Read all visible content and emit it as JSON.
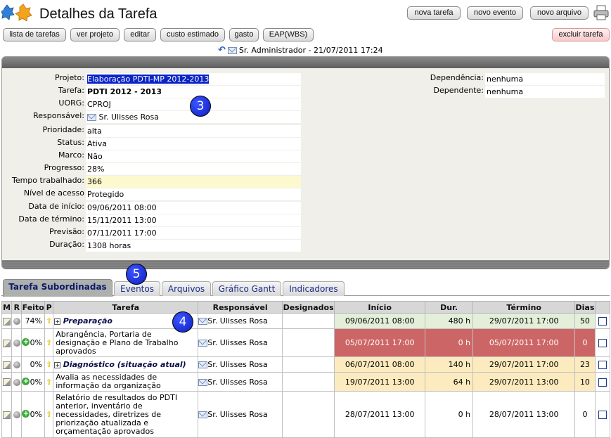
{
  "header": {
    "title": "Detalhes da Tarefa",
    "buttons": {
      "nova_tarefa": "nova tarefa",
      "novo_evento": "novo evento",
      "novo_arquivo": "novo arquivo"
    }
  },
  "toolbar": {
    "lista": "lista de tarefas",
    "ver_projeto": "ver projeto",
    "editar": "editar",
    "custo": "custo estimado",
    "gasto": "gasto",
    "eap": "EAP(WBS)",
    "excluir": "excluir tarefa"
  },
  "userline": "Sr. Administrador - 21/07/2011 17:24",
  "fields": {
    "projeto": {
      "label": "Projeto:",
      "value": "Elaboração PDTI-MP 2012-2013"
    },
    "tarefa": {
      "label": "Tarefa:",
      "value": "PDTI 2012 - 2013"
    },
    "uorg": {
      "label": "UORG:",
      "value": "CPROJ"
    },
    "responsavel": {
      "label": "Responsável:",
      "value": "Sr. Ulisses Rosa"
    },
    "prioridade": {
      "label": "Prioridade:",
      "value": "alta"
    },
    "status": {
      "label": "Status:",
      "value": "Ativa"
    },
    "marco": {
      "label": "Marco:",
      "value": "Não"
    },
    "progresso": {
      "label": "Progresso:",
      "value": "28%"
    },
    "tempo": {
      "label": "Tempo trabalhado:",
      "value": "366"
    },
    "nivel": {
      "label": "Nível de acesso",
      "value": "Protegido"
    },
    "inicio": {
      "label": "Data de início:",
      "value": "09/06/2011 08:00"
    },
    "termino": {
      "label": "Data de término:",
      "value": "15/11/2011 13:00"
    },
    "previsao": {
      "label": "Previsão:",
      "value": "07/11/2011 17:00"
    },
    "duracao": {
      "label": "Duração:",
      "value": "1308 horas"
    },
    "dependencia": {
      "label": "Dependência:",
      "value": "nenhuma"
    },
    "dependente": {
      "label": "Dependente:",
      "value": "nenhuma"
    }
  },
  "badges": {
    "b3": "3",
    "b4": "4",
    "b5": "5"
  },
  "tabs": [
    "Tarefa Subordinadas",
    "Eventos",
    "Arquivos",
    "Gráfico Gantt",
    "Indicadores"
  ],
  "table": {
    "headers": [
      "M",
      "R",
      "Feito",
      "P",
      "Tarefa",
      "Responsável",
      "Designados",
      "Início",
      "Dur.",
      "Término",
      "Dias"
    ],
    "rows": [
      {
        "feito": "74%",
        "tarefa": "Preparação",
        "resp": "Sr. Ulisses Rosa",
        "inicio": "09/06/2011 08:00",
        "dur": "480 h",
        "termino": "29/07/2011 17:00",
        "dias": "50"
      },
      {
        "feito": "0%",
        "tarefa": "Abrangência, Portaria de designação e Plano de Trabalho aprovados",
        "resp": "Sr. Ulisses Rosa",
        "inicio": "05/07/2011 17:00",
        "dur": "0 h",
        "termino": "05/07/2011 17:00",
        "dias": "0"
      },
      {
        "feito": "0%",
        "tarefa": "Diagnóstico (situação atual)",
        "resp": "Sr. Ulisses Rosa",
        "inicio": "06/07/2011 08:00",
        "dur": "140 h",
        "termino": "29/07/2011 17:00",
        "dias": "23"
      },
      {
        "feito": "0%",
        "tarefa": "Avalia as necessidades de informação da organização",
        "resp": "Sr. Ulisses Rosa",
        "inicio": "19/07/2011 13:00",
        "dur": "64 h",
        "termino": "29/07/2011 13:00",
        "dias": "10"
      },
      {
        "feito": "0%",
        "tarefa": "Relatório de resultados do PDTI anterior, inventário de necessidades, diretrizes de priorização atualizada e orçamentação aprovados",
        "resp": "Sr. Ulisses Rosa",
        "inicio": "28/07/2011 13:00",
        "dur": "0 h",
        "termino": "28/07/2011 13:00",
        "dias": "0"
      }
    ]
  }
}
